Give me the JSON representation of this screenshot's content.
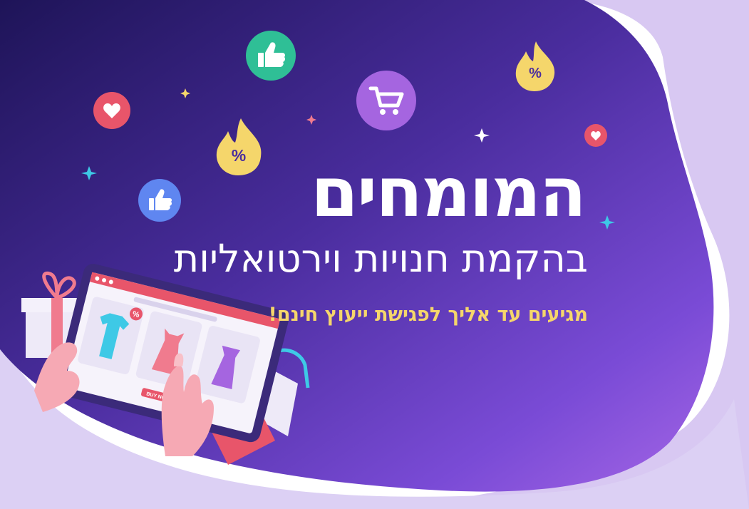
{
  "banner": {
    "headline": "המומחים",
    "subheadline": "בהקמת חנויות וירטואליות",
    "tagline": "מגיעים עד אליך לפגישת ייעוץ חינם!"
  },
  "illustration": {
    "buy_button_label": "BUY NOW",
    "discount_symbol": "%"
  },
  "icons": [
    "thumbs-up-icon",
    "heart-icon",
    "shopping-cart-icon",
    "percent-flame-icon",
    "sparkle-icon",
    "gift-icon",
    "tablet-icon",
    "shopping-bag-icon",
    "credit-card-icon"
  ],
  "colors": {
    "background_dark": "#2b1b6e",
    "background_mid": "#6b3fc8",
    "background_light": "#a566e6",
    "lavender_blob": "#d8c8f2",
    "headline": "#ffffff",
    "tagline": "#f5d66b",
    "teal_bubble": "#2fbf96",
    "cart_bubble": "#a565e0",
    "heart_bubble": "#e8556a",
    "flame_yellow": "#f5d66b",
    "like_bubble": "#5f86f0"
  }
}
